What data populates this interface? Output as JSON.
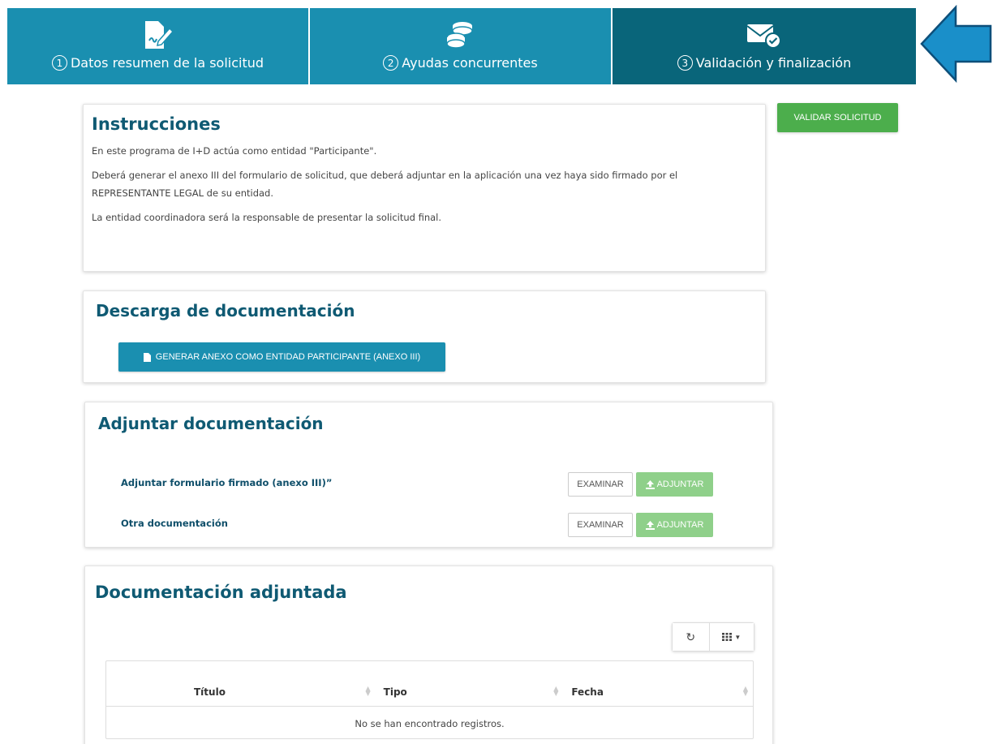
{
  "steps": [
    {
      "num": "1",
      "label": "Datos resumen de la solicitud",
      "icon": "signed-document-icon"
    },
    {
      "num": "2",
      "label": "Ayudas concurrentes",
      "icon": "coins-icon"
    },
    {
      "num": "3",
      "label": "Validación y finalización",
      "icon": "envelope-check-icon"
    }
  ],
  "actions": {
    "validar_label": "VALIDAR SOLICITUD"
  },
  "instrucciones": {
    "title": "Instrucciones",
    "p1": "En este programa de I+D actúa como entidad \"Participante\".",
    "p2": "Deberá generar el anexo III del formulario de solicitud, que deberá adjuntar en la aplicación una vez haya sido firmado por el REPRESENTANTE LEGAL de su entidad.",
    "p3": "La entidad coordinadora será la responsable de presentar la solicitud final."
  },
  "descarga": {
    "title": "Descarga de documentación",
    "button_label": "GENERAR ANEXO COMO ENTIDAD PARTICIPANTE (ANEXO III)"
  },
  "adjuntar": {
    "title": "Adjuntar documentación",
    "rows": [
      {
        "label": "Adjuntar formulario firmado (anexo III)”",
        "examinar": "EXAMINAR",
        "adjuntar": "ADJUNTAR"
      },
      {
        "label": "Otra documentación",
        "examinar": "EXAMINAR",
        "adjuntar": "ADJUNTAR"
      }
    ]
  },
  "adjuntada": {
    "title": "Documentación adjuntada",
    "columns": [
      "Título",
      "Tipo",
      "Fecha"
    ],
    "empty_text": "No se han encontrado registros."
  },
  "colors": {
    "step_active": "#09657a",
    "step": "#1a8fb0",
    "heading": "#0f5a73",
    "validate": "#4cae4c",
    "attach": "#8fd08a",
    "arrow": "#1a8fc9"
  }
}
